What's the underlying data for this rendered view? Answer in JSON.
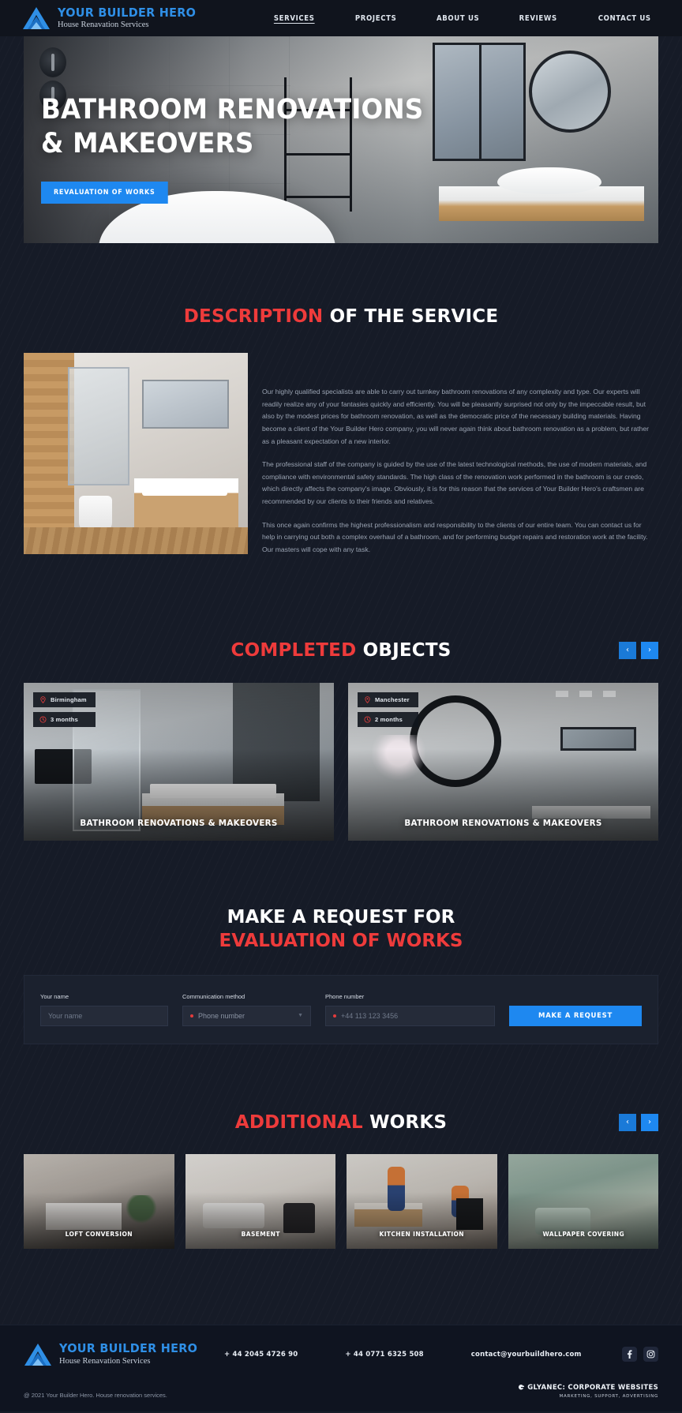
{
  "header": {
    "brand_name": "YOUR BUILDER HERO",
    "brand_sub": "House Renavation Services",
    "nav": [
      {
        "label": "SERVICES",
        "active": true
      },
      {
        "label": "PROJECTS",
        "active": false
      },
      {
        "label": "ABOUT US",
        "active": false
      },
      {
        "label": "REVIEWS",
        "active": false
      },
      {
        "label": "CONTACT US",
        "active": false
      }
    ]
  },
  "hero": {
    "title_line1": "BATHROOM RENOVATIONS",
    "title_line2": "& MAKEOVERS",
    "cta_label": "REVALUATION OF WORKS"
  },
  "description": {
    "heading_highlight": "DESCRIPTION",
    "heading_rest": " OF THE SERVICE",
    "paragraphs": [
      "Our highly qualified specialists are able to carry out turnkey bathroom renovations of any complexity and type. Our experts will readily realize any of your fantasies quickly and efficiently. You will be pleasantly surprised not only by the impeccable result, but also by the modest prices for bathroom renovation, as well as the democratic price of the necessary building materials. Having become a client of the Your Builder Hero company, you will never again think about bathroom renovation as a problem, but rather as a pleasant expectation of a new interior.",
      "The professional staff of the company is guided by the use of the latest technological methods, the use of modern materials, and compliance with environmental safety standards. The high class of the renovation work performed in the bathroom is our credo, which directly affects the company's image. Obviously, it is for this reason that the services of Your Builder Hero's craftsmen are recommended by our clients to their friends and relatives.",
      "This once again confirms the highest professionalism and responsibility to the clients of our entire team. You can contact us for help in carrying out both a complex overhaul of a bathroom, and for performing budget repairs and restoration work at the facility. Our masters will cope with any task."
    ]
  },
  "completed": {
    "heading_highlight": "COMPLETED",
    "heading_rest": " OBJECTS",
    "prev_label": "‹",
    "next_label": "›",
    "cards": [
      {
        "location": "Birmingham",
        "duration": "3 months",
        "title": "BATHROOM RENOVATIONS & MAKEOVERS"
      },
      {
        "location": "Manchester",
        "duration": "2 months",
        "title": "BATHROOM RENOVATIONS & MAKEOVERS"
      }
    ]
  },
  "request": {
    "heading_line1": "MAKE A REQUEST FOR",
    "heading_line2": "EVALUATION OF WORKS",
    "name_label": "Your name",
    "name_placeholder": "Your name",
    "name_value": "",
    "method_label": "Communication method",
    "method_value": "Phone number",
    "phone_label": "Phone number",
    "phone_placeholder": "+44 113 123 3456",
    "phone_value": "",
    "submit_label": "MAKE A REQUEST"
  },
  "additional": {
    "heading_highlight": "ADDITIONAL",
    "heading_rest": " WORKS",
    "prev_label": "‹",
    "next_label": "›",
    "cards": [
      {
        "title": "LOFT CONVERSION"
      },
      {
        "title": "BASEMENT"
      },
      {
        "title": "KITCHEN INSTALLATION"
      },
      {
        "title": "WALLPAPER COVERING"
      }
    ]
  },
  "footer": {
    "brand_name": "YOUR BUILDER HERO",
    "brand_sub": "House Renavation Services",
    "phone1": "+ 44 2045 4726 90",
    "phone2": "+ 44 0771 6325 508",
    "email": "contact@yourbuildhero.com",
    "copyright": "@ 2021 Your Builder Hero. House renovation services.",
    "agency_name": "GLYANEC: CORPORATE WEBSITES",
    "agency_sub": "MARKETING, SUPPORT, ADVERTISING"
  },
  "colors": {
    "accent_blue": "#1e88f0",
    "accent_red": "#ee3b3b",
    "background": "#161b27",
    "panel": "#1b212e"
  }
}
